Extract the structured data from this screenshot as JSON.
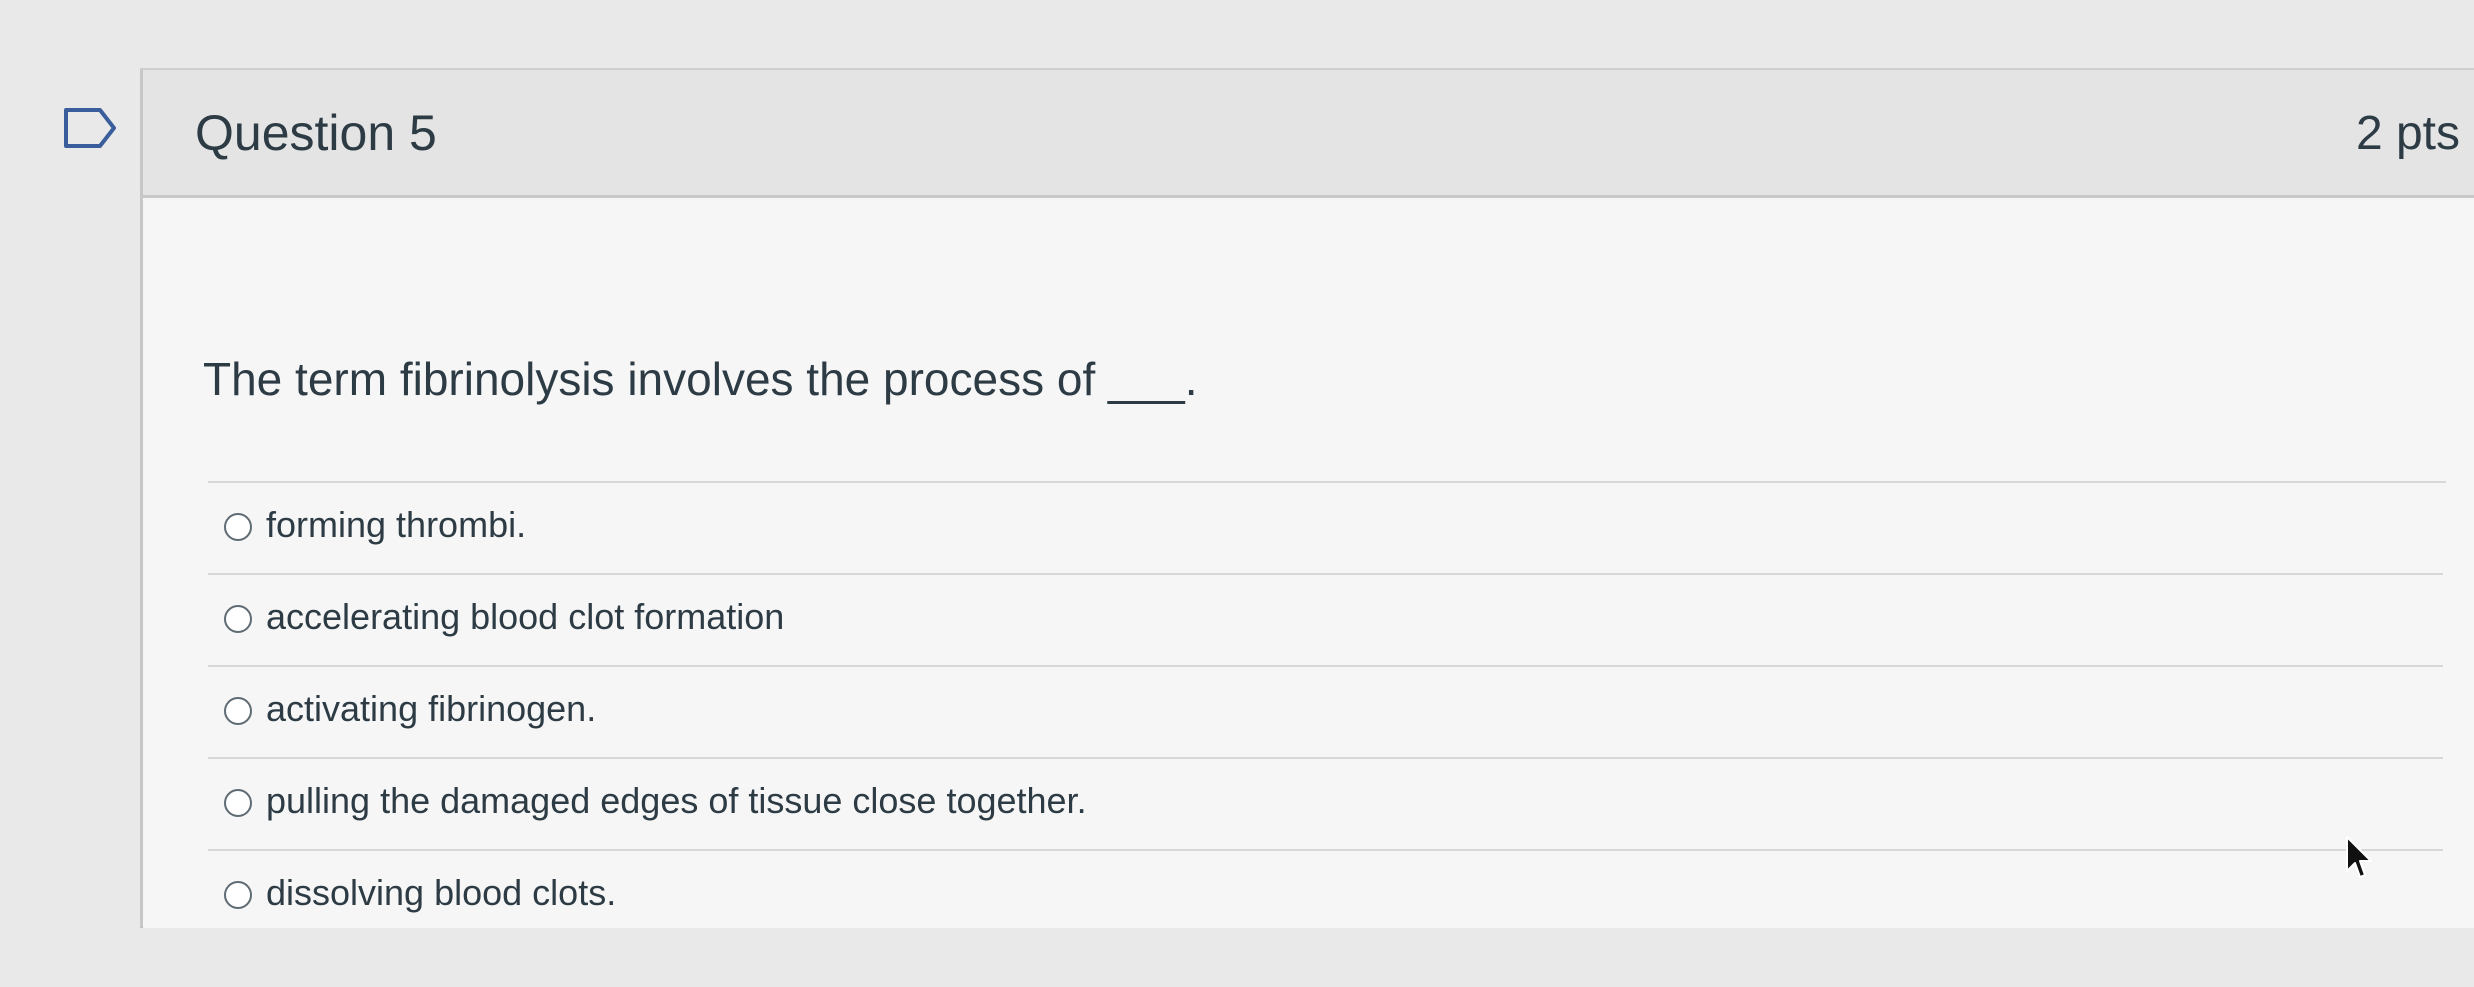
{
  "question": {
    "title": "Question 5",
    "points": "2 pts",
    "prompt": "The term fibrinolysis involves the process of ___.",
    "answers": [
      {
        "label": "forming thrombi."
      },
      {
        "label": "accelerating blood clot formation"
      },
      {
        "label": "activating fibrinogen."
      },
      {
        "label": "pulling the damaged edges of tissue close together."
      },
      {
        "label": "dissolving blood clots."
      }
    ]
  },
  "icons": {
    "flag": "flag-icon",
    "radio": "radio-button",
    "cursor": "mouse-cursor-icon"
  },
  "colors": {
    "page_background": "#e9e9e9",
    "card_background": "#f3f3f3",
    "header_background": "#e4e4e4",
    "text": "#2d3b45",
    "radio_border": "#5f6b73",
    "divider": "#d8d8d8"
  }
}
